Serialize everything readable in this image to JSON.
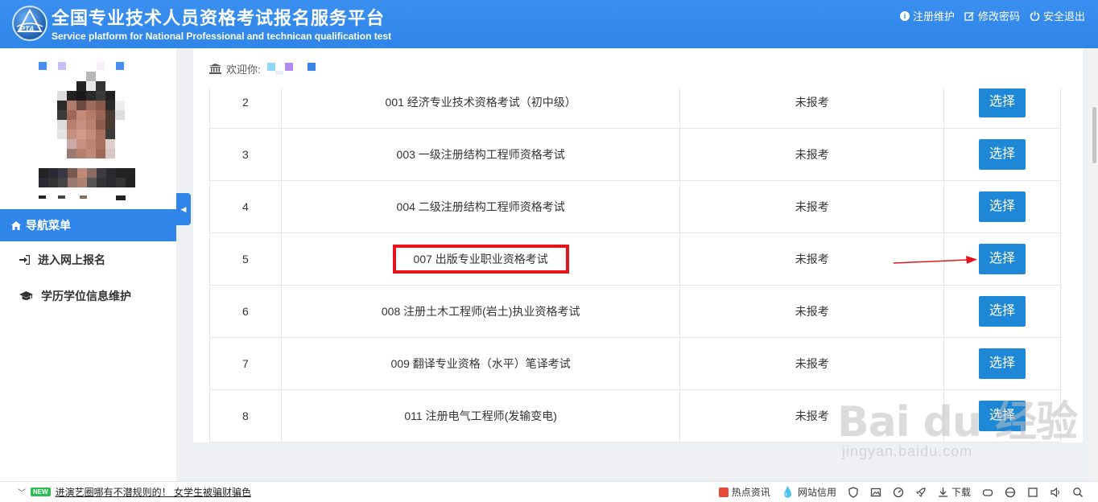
{
  "header": {
    "title_cn": "全国专业技术人员资格考试报名服务平台",
    "title_en": "Service platform for National Professional and technican qualification test",
    "logo_text": "PTA",
    "links": [
      {
        "icon": "info-icon",
        "label": "注册维护"
      },
      {
        "icon": "edit-icon",
        "label": "修改密码"
      },
      {
        "icon": "power-icon",
        "label": "安全退出"
      }
    ]
  },
  "sidebar": {
    "nav_title": "导航菜单",
    "items": [
      {
        "icon": "sign-in-icon",
        "label": "进入网上报名"
      },
      {
        "icon": "graduation-cap-icon",
        "label": "学历学位信息维护"
      }
    ]
  },
  "welcome": {
    "label": "欢迎你:"
  },
  "exam_table": {
    "rows": [
      {
        "no": "2",
        "name": "001 经济专业技术资格考试（初中级）",
        "status": "未报考",
        "action": "选择"
      },
      {
        "no": "3",
        "name": "003 一级注册结构工程师资格考试",
        "status": "未报考",
        "action": "选择"
      },
      {
        "no": "4",
        "name": "004 二级注册结构工程师资格考试",
        "status": "未报考",
        "action": "选择"
      },
      {
        "no": "5",
        "name": "007 出版专业职业资格考试",
        "status": "未报考",
        "action": "选择"
      },
      {
        "no": "6",
        "name": "008 注册土木工程师(岩土)执业资格考试",
        "status": "未报考",
        "action": "选择"
      },
      {
        "no": "7",
        "name": "009 翻译专业资格（水平）笔译考试",
        "status": "未报考",
        "action": "选择"
      },
      {
        "no": "8",
        "name": "011 注册电气工程师(发输变电)",
        "status": "未报考",
        "action": "选择"
      }
    ]
  },
  "statusbar": {
    "new_badge": "NEW",
    "news": "进演艺圈哪有不潜规则的！ 女学生被骗财骗色",
    "hot_news": "热点资讯",
    "credit": "网站信用",
    "download": "下载"
  },
  "watermark": {
    "main": "Bai du 经验",
    "sub": "jingyan.baidu.com"
  },
  "colors": {
    "primary": "#2f86e8",
    "button": "#1e88d6",
    "highlight": "#e8141b"
  }
}
